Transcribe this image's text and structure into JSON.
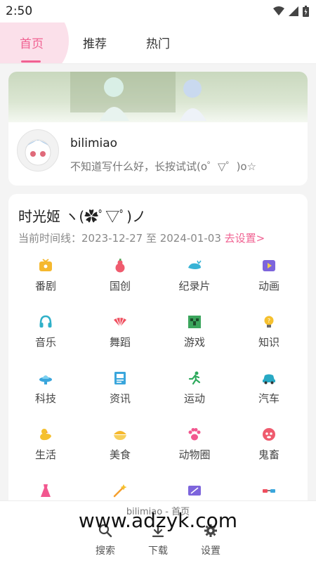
{
  "status_bar": {
    "time": "2:50"
  },
  "tabs": [
    {
      "label": "首页",
      "active": true
    },
    {
      "label": "推荐",
      "active": false
    },
    {
      "label": "热门",
      "active": false
    }
  ],
  "accent_color": "#f06292",
  "user": {
    "name": "bilimiao",
    "signature": "不知道写什么好，长按试试(o゜▽゜)o☆"
  },
  "timeline": {
    "title": "时光姬 ヽ(✿ﾟ▽ﾟ)ノ",
    "range_label": "当前时间线：2023-12-27 至 2024-01-03",
    "settings_link": "去设置>"
  },
  "categories": [
    {
      "label": "番剧",
      "icon": "tv-icon"
    },
    {
      "label": "国创",
      "icon": "gourd-icon"
    },
    {
      "label": "纪录片",
      "icon": "whale-icon"
    },
    {
      "label": "动画",
      "icon": "play-icon"
    },
    {
      "label": "音乐",
      "icon": "headphones-icon"
    },
    {
      "label": "舞蹈",
      "icon": "fan-icon"
    },
    {
      "label": "游戏",
      "icon": "creeper-icon"
    },
    {
      "label": "知识",
      "icon": "bulb-icon"
    },
    {
      "label": "科技",
      "icon": "ufo-icon"
    },
    {
      "label": "资讯",
      "icon": "news-icon"
    },
    {
      "label": "运动",
      "icon": "runner-icon"
    },
    {
      "label": "汽车",
      "icon": "car-icon"
    },
    {
      "label": "生活",
      "icon": "duck-icon"
    },
    {
      "label": "美食",
      "icon": "food-icon"
    },
    {
      "label": "动物圈",
      "icon": "paw-icon"
    },
    {
      "label": "鬼畜",
      "icon": "ghost-icon"
    },
    {
      "label": "",
      "icon": "dress-icon"
    },
    {
      "label": "",
      "icon": "wand-icon"
    },
    {
      "label": "",
      "icon": "film-icon"
    },
    {
      "label": "",
      "icon": "glasses-icon"
    }
  ],
  "bottom_nav": {
    "title": "bilimiao - 首页",
    "items": [
      {
        "label": "搜索",
        "icon": "search-icon"
      },
      {
        "label": "下载",
        "icon": "download-icon"
      },
      {
        "label": "设置",
        "icon": "gear-icon"
      }
    ]
  },
  "watermark": "www.adzyk.com"
}
